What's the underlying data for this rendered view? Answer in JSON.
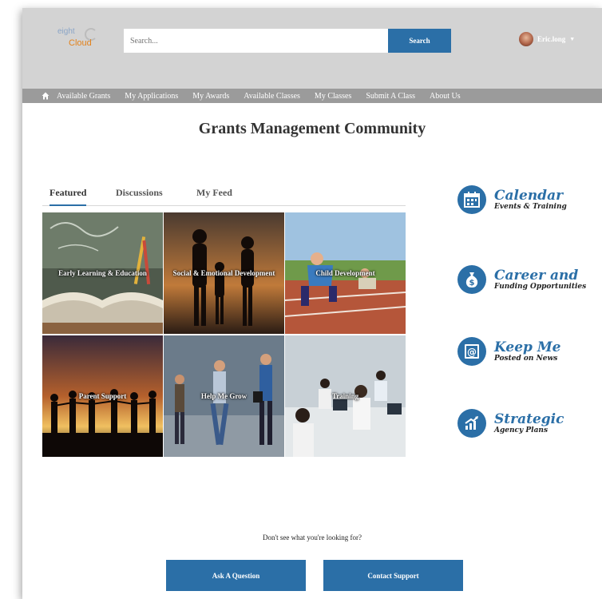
{
  "header": {
    "logo_line1": "eight",
    "logo_line2": "Cloud",
    "search_placeholder": "Search...",
    "search_button": "Search",
    "user_name": "Eric.long"
  },
  "nav": {
    "home_icon": "home-icon",
    "items": [
      "Available Grants",
      "My Applications",
      "My Awards",
      "Available Classes",
      "My Classes",
      "Submit A Class",
      "About Us"
    ]
  },
  "page_title": "Grants Management Community",
  "tabs": [
    {
      "label": "Featured",
      "active": true
    },
    {
      "label": "Discussions",
      "active": false
    },
    {
      "label": "My Feed",
      "active": false
    }
  ],
  "tiles": [
    {
      "label": "Early Learning & Education"
    },
    {
      "label": "Social & Emotional Development"
    },
    {
      "label": "Child Development"
    },
    {
      "label": "Parent Support"
    },
    {
      "label": "Help Me Grow"
    },
    {
      "label": "Training"
    }
  ],
  "promos": [
    {
      "icon": "calendar-icon",
      "big": "Calendar",
      "small": "Events & Training"
    },
    {
      "icon": "money-bag-icon",
      "big": "Career and",
      "small": "Funding Opportunities"
    },
    {
      "icon": "at-sign-stamp-icon",
      "big": "Keep Me",
      "small": "Posted on News"
    },
    {
      "icon": "growth-chart-icon",
      "big": "Strategic",
      "small": "Agency Plans"
    }
  ],
  "footer": {
    "prompt": "Don't see what you're looking for?",
    "ask_button": "Ask A Question",
    "contact_button": "Contact Support"
  },
  "colors": {
    "accent": "#2b6fa7",
    "header_bg": "#d3d3d3",
    "nav_bg": "#9b9b9b"
  }
}
